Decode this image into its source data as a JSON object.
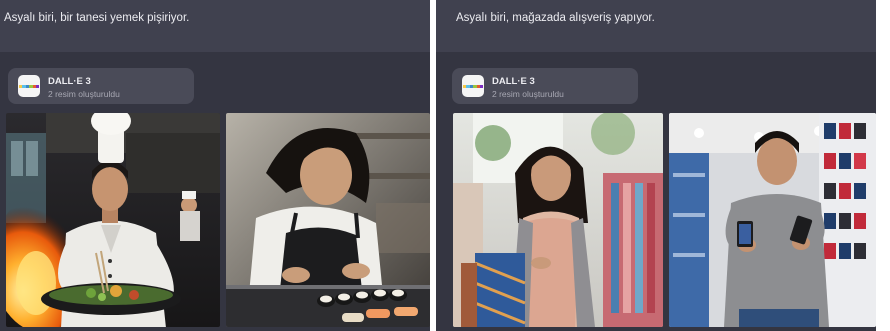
{
  "panels": [
    {
      "prompt": "Asyalı biri, bir tanesi yemek pişiriyor.",
      "tool": {
        "name": "DALL·E 3",
        "subtitle": "2 resim oluşturuldu"
      },
      "images": [
        {
          "subject": "chef cooking in a flaming wok"
        },
        {
          "subject": "chef preparing sushi"
        }
      ]
    },
    {
      "prompt": "Asyalı biri, mağazada alışveriş yapıyor.",
      "tool": {
        "name": "DALL·E 3",
        "subtitle": "2 resim oluşturuldu"
      },
      "images": [
        {
          "subject": "woman shopping for clothes"
        },
        {
          "subject": "man looking at phones in electronics store"
        }
      ]
    }
  ],
  "colors": {
    "panel_bg": "#343541",
    "bar_bg": "#40414f",
    "card_bg": "#4a4b58",
    "text_primary": "#ececf1",
    "text_secondary": "#a8a8b3",
    "logo_stripes": [
      "#f7c948",
      "#5bc0eb",
      "#3f88c5",
      "#9bc53d",
      "#e55934",
      "#7b2cbf"
    ]
  },
  "icons": [
    "dalle-logo-icon"
  ]
}
